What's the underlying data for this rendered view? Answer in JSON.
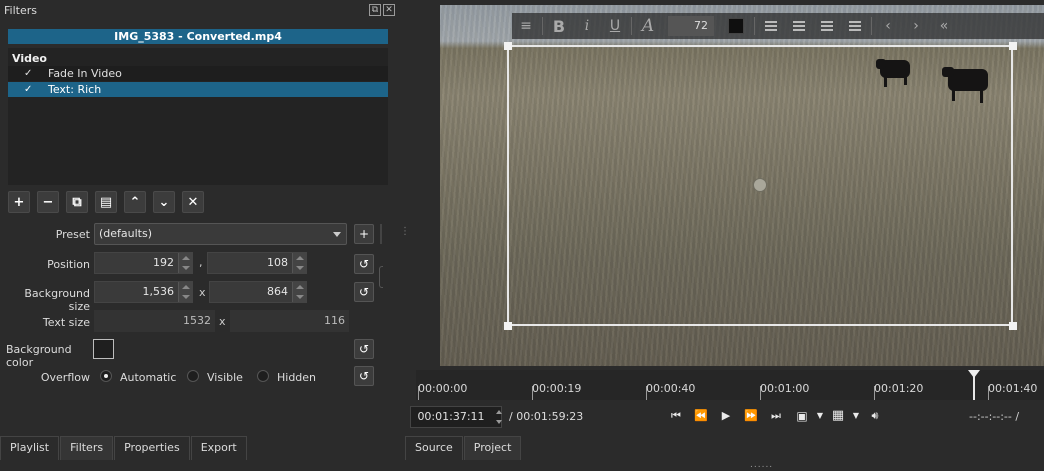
{
  "filters": {
    "panel_title": "Filters",
    "clip_name": "IMG_5383 - Converted.mp4",
    "section_label": "Video",
    "items": [
      {
        "check": "✓",
        "label": "Fade In Video"
      },
      {
        "check": "✓",
        "label": "Text: Rich"
      }
    ],
    "toolbar": {
      "add": "+",
      "remove": "−",
      "copy": "⧉",
      "paste": "▤",
      "up": "⌃",
      "down": "⌄",
      "clear": "✕"
    }
  },
  "properties": {
    "preset_label": "Preset",
    "preset_value": "(defaults)",
    "position_label": "Position",
    "position_x": "192",
    "position_sep": ",",
    "position_y": "108",
    "bg_size_label": "Background size",
    "bg_size_w": "1,536",
    "bg_size_sep": "x",
    "bg_size_h": "864",
    "text_size_label": "Text size",
    "text_size_w": "1532",
    "text_size_sep": "x",
    "text_size_h": "116",
    "bg_color_label": "Background color",
    "bg_color_value": "#1f1f1f",
    "overflow_label": "Overflow",
    "overflow_options": [
      "Automatic",
      "Visible",
      "Hidden"
    ],
    "overflow_selected": "Automatic"
  },
  "left_tabs": [
    "Playlist",
    "Filters",
    "Properties",
    "Export"
  ],
  "left_tab_active": "Filters",
  "viewer": {
    "text_toolbar": {
      "menu": "≡",
      "bold": "B",
      "italic": "i",
      "underline": "U",
      "font": "A",
      "font_size": "72",
      "text_color": "#0f0f0f",
      "prev": "‹",
      "next": "›",
      "collapse": "«"
    }
  },
  "timeline": {
    "labels": [
      "00:00:00",
      "00:00:19",
      "00:00:40",
      "00:01:00",
      "00:01:20",
      "00:01:40"
    ],
    "playhead_position": "00:01:37:11"
  },
  "transport": {
    "current_time": "00:01:37:11",
    "duration": "/ 00:01:59:23",
    "skip_start": "⏮",
    "rewind": "⏪",
    "play": "▶",
    "fast_forward": "⏩",
    "skip_end": "⏭",
    "right_timecode": "--:--:--:-- /"
  },
  "viewer_tabs": [
    "Source",
    "Project"
  ],
  "viewer_tab_active": "Project",
  "colors": {
    "accent": "#1d6489",
    "panel_bg": "#2b2b2b"
  }
}
